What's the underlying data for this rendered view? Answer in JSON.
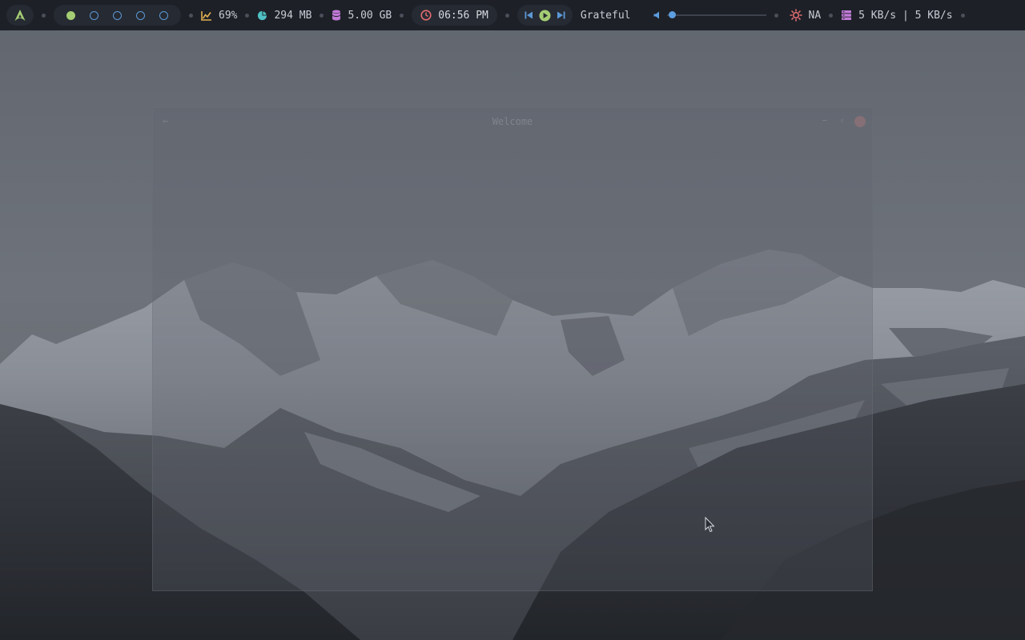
{
  "colors": {
    "bar_bg": "#1d2027",
    "pill_bg": "#262a32",
    "workspace_active": "#a4cd74",
    "workspace_empty": "#5c98d6",
    "cpu_icon": "#e0b050",
    "memory_icon": "#4fc1c4",
    "disk_icon": "#c07ad6",
    "clock_icon": "#e06c6f",
    "media_icon": "#5c98d6",
    "play_icon": "#a4cd74",
    "volume_icon": "#5c9ee0",
    "weather_icon": "#e06c6f",
    "network_icon": "#c07ad6"
  },
  "topbar": {
    "launcher_icon": "arch-logo-icon",
    "workspaces": [
      {
        "state": "active"
      },
      {
        "state": "empty"
      },
      {
        "state": "empty"
      },
      {
        "state": "empty"
      },
      {
        "state": "empty"
      }
    ],
    "cpu": {
      "icon": "cpu-chart-icon",
      "value": "69%"
    },
    "memory": {
      "icon": "memory-pie-icon",
      "value": "294 MB"
    },
    "disk": {
      "icon": "disk-database-icon",
      "value": "5.00 GB"
    },
    "clock": {
      "icon": "clock-icon",
      "value": "06:56 PM"
    },
    "media": {
      "prev_icon": "skip-previous-icon",
      "play_icon": "play-icon",
      "next_icon": "skip-next-icon",
      "title": "Grateful"
    },
    "volume": {
      "icon": "speaker-icon",
      "level": 0.02
    },
    "weather": {
      "icon": "weather-sun-icon",
      "value": "NA"
    },
    "network": {
      "icon": "network-icon",
      "value": "5 KB/s | 5 KB/s"
    }
  },
  "window": {
    "title": "Welcome",
    "back_icon": "arrow-back-icon",
    "minimize_icon": "minimize-icon",
    "maximize_icon": "maximize-icon",
    "close_icon": "close-icon"
  },
  "wallpaper": {
    "subject": "snow-capped mountain range"
  }
}
